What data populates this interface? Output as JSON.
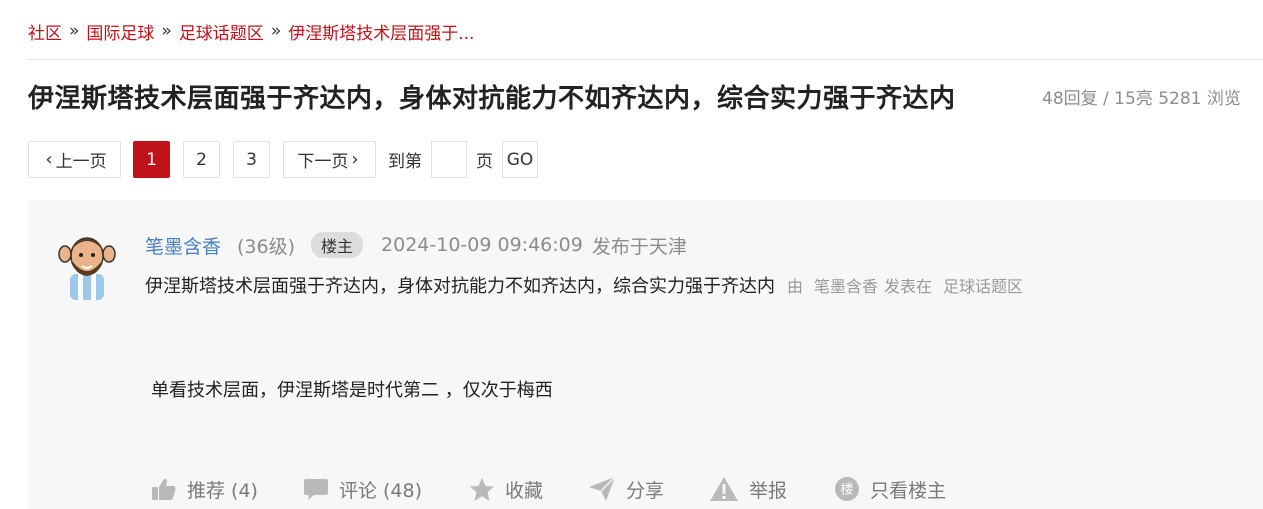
{
  "breadcrumb": {
    "items": [
      "社区",
      "国际足球",
      "足球话题区",
      "伊涅斯塔技术层面强于..."
    ],
    "separator": "»"
  },
  "thread": {
    "title": "伊涅斯塔技术层面强于齐达内，身体对抗能力不如齐达内，综合实力强于齐达内",
    "stats": "48回复 / 15亮 5281 浏览"
  },
  "pager": {
    "prev_label": "上一页",
    "pages": [
      "1",
      "2",
      "3"
    ],
    "current_page": "1",
    "next_label": "下一页",
    "goto_label": "到第",
    "page_label": "页",
    "go_label": "GO",
    "goto_value": ""
  },
  "post": {
    "author": "笔墨含香",
    "level": "(36级)",
    "badge": "楼主",
    "time": "2024-10-09 09:46:09",
    "location": "发布于天津",
    "subject": "伊涅斯塔技术层面强于齐达内，身体对抗能力不如齐达内，综合实力强于齐达内",
    "by_label": "由",
    "by_author": "笔墨含香",
    "by_verb": "发表在",
    "forum": "足球话题区",
    "body": "单看技术层面，伊涅斯塔是时代第二 ，仅次于梅西",
    "actions": {
      "like": "推荐 (4)",
      "comment": "评论 (48)",
      "favorite": "收藏",
      "share": "分享",
      "report": "举报",
      "only_op_icon": "楼",
      "only_op": "只看楼主"
    }
  },
  "icons": {
    "prev": "chevron-left-icon",
    "next": "chevron-right-icon",
    "like": "thumbs-up-icon",
    "comment": "comment-bubble-icon",
    "favorite": "star-icon",
    "share": "paper-plane-icon",
    "report": "warning-triangle-icon",
    "only_op": "circle-badge-icon"
  },
  "colors": {
    "brand_red": "#c0121a",
    "author_blue": "#4a7fc1",
    "muted": "#8c8c8c",
    "post_bg": "#f7f7f7"
  }
}
